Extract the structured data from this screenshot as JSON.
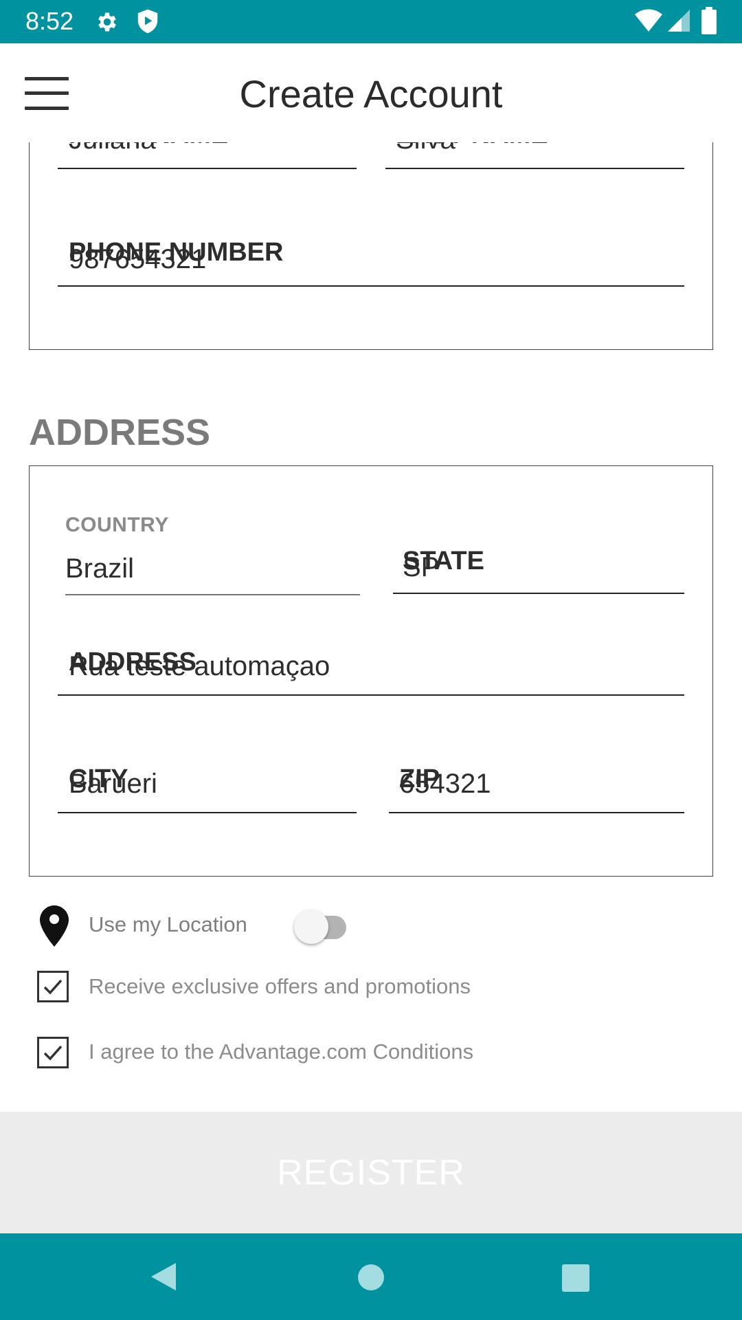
{
  "status_bar": {
    "time": "8:52",
    "icons": [
      "settings-gear-icon",
      "shield-play-icon",
      "wifi-icon",
      "cell-signal-icon",
      "battery-icon"
    ]
  },
  "app_bar": {
    "title": "Create Account",
    "menu_icon": "hamburger-menu-icon"
  },
  "account_details": {
    "first_name_label": "FIRST NAME",
    "first_name_value": "Juliana",
    "last_name_label": "LAST NAME",
    "last_name_value": "Silva",
    "phone_label": "PHONE NUMBER",
    "phone_value": "987654321"
  },
  "address_section": {
    "heading": "ADDRESS",
    "country_label": "COUNTRY",
    "country_value": "Brazil",
    "state_label": "STATE",
    "state_value": "SP",
    "address_label": "ADDRESS",
    "address_value": "Rua teste automaçao",
    "city_label": "CITY",
    "city_value": "Barueri",
    "zip_label": "ZIP",
    "zip_value": "654321"
  },
  "options": {
    "location_label": "Use my Location",
    "location_enabled": false,
    "offers_label": "Receive exclusive offers and promotions",
    "offers_checked": true,
    "conditions_label": "I agree to the Advantage.com Conditions",
    "conditions_checked": true
  },
  "register": {
    "label": "REGISTER",
    "enabled": false
  },
  "colors": {
    "primary": "#00939f",
    "register_disabled_bg": "#ececec"
  },
  "nav_bar": {
    "icons": [
      "back-icon",
      "home-icon",
      "recents-icon"
    ]
  }
}
